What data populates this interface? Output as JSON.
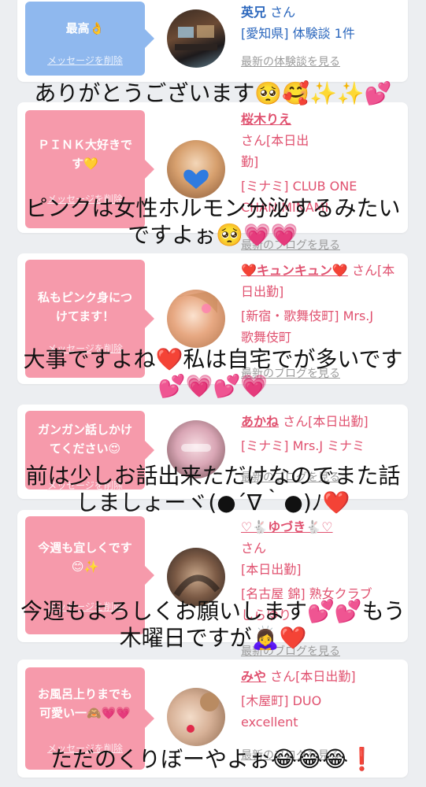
{
  "cards": [
    {
      "message": "最高👌",
      "delete_label": "メッセージを削除",
      "name": "英兄",
      "honorific": "さん",
      "meta": "[愛知県] 体験談 1件",
      "link": "最新の体験談を見る"
    },
    {
      "message": "ＰＩＮＫ大好きで\nす💛",
      "delete_label": "メッセージを削除",
      "name": "桜木りえ",
      "honorific": "さん[本日出\n勤]",
      "meta": "[ミナミ] CLUB ONE\nCHAN MINAMI",
      "link": "最新のブログを見る"
    },
    {
      "message": "私もピンク身につ\nけてます！",
      "delete_label": "メッセージを削除",
      "name": "❤️キュンキュン❤️",
      "honorific": "さん[本日出勤]",
      "meta": "[新宿・歌舞伎町] Mrs.J\n歌舞伎町",
      "link": "最新のブログを見る"
    },
    {
      "message": "ガンガン話しかけ\nてください😍",
      "delete_label": "メッセージを削除",
      "name": "あかね",
      "honorific": "さん[本日出勤]",
      "meta": "[ミナミ] Mrs.J ミナミ",
      "link": "最新のブログを見る"
    },
    {
      "message": "今週も宜しくです\n😊✨",
      "delete_label": "メッセージを削除",
      "name": "♡🐇ゆづき🐇♡",
      "honorific": "さん\n[本日出勤]",
      "meta": "[名古屋 錦] 熟女クラブ\nしらゆり",
      "link": "最新のブログを見る"
    },
    {
      "message": "お風呂上りまでも\n可愛い一🙈💗💗",
      "delete_label": "メッセージを削除",
      "name": "みや",
      "honorific": "さん[本日出勤]",
      "meta": "[木屋町] DUO\nexcellent",
      "link": "最新のブログを見る"
    }
  ],
  "comments": [
    "ありがとうございます🥺🥰✨✨💕",
    "ピンクは女性ホルモン分泌するみたい\nですよぉ🥺💗💗",
    "大事ですよね❤️私は自宅でが多いです\n💕💗💕💗",
    "前は少しお話出来ただけなのでまた話\nしましょーヾ(●´∇｀●)ﾉ❤️",
    "今週もよろしくお願いします💕💕もう\n木曜日ですが🙇‍♀️❤️",
    "ただのくりぼーやよぉ😂😂😂❗️"
  ]
}
